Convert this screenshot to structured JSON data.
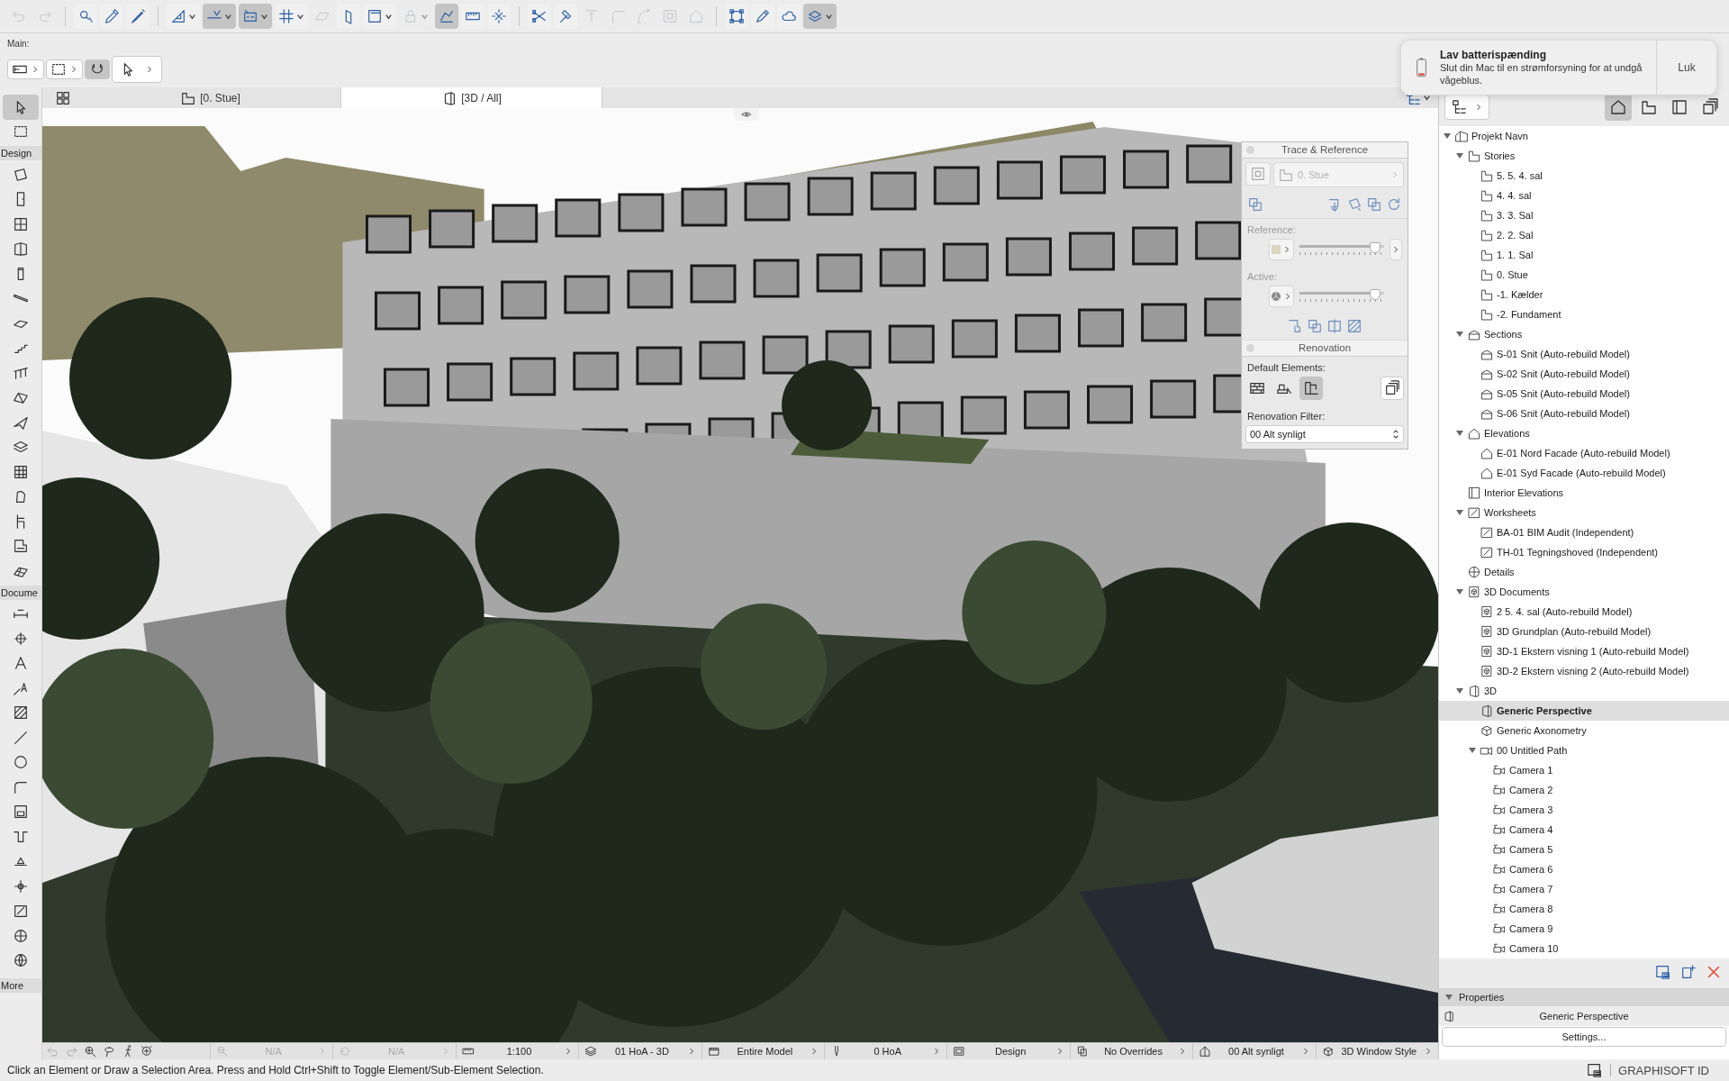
{
  "toolbar": [
    [
      {
        "selected": false,
        "disabled": true,
        "dropdown": false
      },
      {
        "selected": false,
        "disabled": true,
        "dropdown": false
      }
    ],
    [
      {
        "selected": false,
        "disabled": false,
        "dropdown": false
      },
      {
        "selected": false,
        "disabled": false,
        "dropdown": false
      },
      {
        "selected": false,
        "disabled": false,
        "dropdown": false
      }
    ],
    [
      {
        "selected": false,
        "disabled": false,
        "dropdown": true
      },
      {
        "selected": true,
        "disabled": false,
        "dropdown": true
      },
      {
        "selected": true,
        "disabled": false,
        "dropdown": true
      },
      {
        "selected": false,
        "disabled": false,
        "dropdown": true
      },
      {
        "selected": false,
        "disabled": true,
        "dropdown": false
      },
      {
        "selected": false,
        "disabled": false,
        "dropdown": false
      },
      {
        "selected": false,
        "disabled": false,
        "dropdown": true
      },
      {
        "selected": false,
        "disabled": true,
        "dropdown": true
      },
      {
        "selected": true,
        "disabled": false,
        "dropdown": false
      },
      {
        "selected": false,
        "disabled": false,
        "dropdown": false
      },
      {
        "selected": false,
        "disabled": false,
        "dropdown": false
      }
    ],
    [
      {
        "selected": false,
        "disabled": false,
        "dropdown": false
      },
      {
        "selected": false,
        "disabled": false,
        "dropdown": false
      },
      {
        "selected": false,
        "disabled": true,
        "dropdown": false
      },
      {
        "selected": false,
        "disabled": true,
        "dropdown": false
      },
      {
        "selected": false,
        "disabled": true,
        "dropdown": false
      },
      {
        "selected": false,
        "disabled": true,
        "dropdown": false
      },
      {
        "selected": false,
        "disabled": true,
        "dropdown": false
      }
    ],
    [
      {
        "selected": false,
        "disabled": false,
        "dropdown": false
      },
      {
        "selected": false,
        "disabled": false,
        "dropdown": false
      },
      {
        "selected": false,
        "disabled": false,
        "dropdown": false
      },
      {
        "selected": true,
        "disabled": false,
        "dropdown": true
      }
    ]
  ],
  "info_box": {
    "label": "Main:",
    "controls": [
      {
        "selected": false
      },
      {
        "selected": false
      },
      {
        "selected": true
      },
      {
        "selected": false
      }
    ]
  },
  "notification": {
    "title": "Lav batterispænding",
    "body": "Slut din Mac til en strømforsyning for at undgå vågeblus.",
    "button": "Luk"
  },
  "toolbox": {
    "top": [
      {
        "selected": true
      },
      {
        "selected": false
      }
    ],
    "sections": [
      {
        "label": "Design",
        "tools": [
          {
            "selected": false
          },
          {
            "selected": false
          },
          {
            "selected": false
          },
          {
            "selected": false
          },
          {
            "selected": false
          },
          {
            "selected": false
          },
          {
            "selected": false
          },
          {
            "selected": false
          },
          {
            "selected": false
          },
          {
            "selected": false
          },
          {
            "selected": false
          },
          {
            "selected": false
          },
          {
            "selected": false
          },
          {
            "selected": false
          },
          {
            "selected": false
          },
          {
            "selected": false
          },
          {
            "selected": false
          }
        ]
      },
      {
        "label": "Docume",
        "tools": [
          {
            "selected": false
          },
          {
            "selected": false
          },
          {
            "selected": false
          },
          {
            "selected": false
          },
          {
            "selected": false
          },
          {
            "selected": false
          },
          {
            "selected": false
          },
          {
            "selected": false
          },
          {
            "selected": false
          },
          {
            "selected": false
          },
          {
            "selected": false
          },
          {
            "selected": false
          },
          {
            "selected": false
          },
          {
            "selected": false
          },
          {
            "selected": false
          }
        ]
      }
    ],
    "more_label": "More"
  },
  "tabs": [
    {
      "label": "[0. Stue]",
      "kind": "plan",
      "selected": false
    },
    {
      "label": "[3D / All]",
      "kind": "view3d",
      "selected": true
    }
  ],
  "trace_panel": {
    "title": "Trace & Reference",
    "reference_field": {
      "value": "0. Stue",
      "disabled": true
    },
    "reference_label": "Reference:",
    "reference_slider": {
      "level": 0.88
    },
    "active_label": "Active:",
    "active_slider": {
      "level": 0.88
    }
  },
  "renovation_panel": {
    "title": "Renovation",
    "default_label": "Default Elements:",
    "elements": [
      {
        "selected": false
      },
      {
        "selected": false
      },
      {
        "selected": true
      }
    ],
    "filter_label": "Renovation Filter:",
    "filter": {
      "value": "00 Alt synligt"
    }
  },
  "navigator": {
    "views": [
      {
        "selected": true
      },
      {
        "selected": false
      },
      {
        "selected": false
      },
      {
        "selected": false
      }
    ],
    "tree": [
      {
        "label": "Projekt Navn",
        "kind": "project",
        "selected": false,
        "expanded": true,
        "children": [
          {
            "label": "Stories",
            "kind": "story",
            "selected": false,
            "expanded": true,
            "children": [
              {
                "label": "5. 5. 4. sal",
                "kind": "story",
                "selected": false
              },
              {
                "label": "4. 4. sal",
                "kind": "story",
                "selected": false
              },
              {
                "label": "3. 3. Sal",
                "kind": "story",
                "selected": false
              },
              {
                "label": "2. 2. Sal",
                "kind": "story",
                "selected": false
              },
              {
                "label": "1. 1. Sal",
                "kind": "story",
                "selected": false
              },
              {
                "label": "0. Stue",
                "kind": "story",
                "selected": false
              },
              {
                "label": "-1. Kælder",
                "kind": "story",
                "selected": false
              },
              {
                "label": "-2. Fundament",
                "kind": "story",
                "selected": false
              }
            ]
          },
          {
            "label": "Sections",
            "kind": "section",
            "selected": false,
            "expanded": true,
            "children": [
              {
                "label": "S-01 Snit (Auto-rebuild Model)",
                "kind": "section",
                "selected": false
              },
              {
                "label": "S-02 Snit (Auto-rebuild Model)",
                "kind": "section",
                "selected": false
              },
              {
                "label": "S-05 Snit (Auto-rebuild Model)",
                "kind": "section",
                "selected": false
              },
              {
                "label": "S-06 Snit (Auto-rebuild Model)",
                "kind": "section",
                "selected": false
              }
            ]
          },
          {
            "label": "Elevations",
            "kind": "elevation",
            "selected": false,
            "expanded": true,
            "children": [
              {
                "label": "E-01 Nord Facade (Auto-rebuild Model)",
                "kind": "elevation",
                "selected": false
              },
              {
                "label": "E-01 Syd Facade (Auto-rebuild Model)",
                "kind": "elevation",
                "selected": false
              }
            ]
          },
          {
            "label": "Interior Elevations",
            "kind": "interior",
            "selected": false
          },
          {
            "label": "Worksheets",
            "kind": "worksheet",
            "selected": false,
            "expanded": true,
            "children": [
              {
                "label": "BA-01 BIM Audit (Independent)",
                "kind": "worksheet",
                "selected": false
              },
              {
                "label": "TH-01 Tegningshoved (Independent)",
                "kind": "worksheet",
                "selected": false
              }
            ]
          },
          {
            "label": "Details",
            "kind": "detail",
            "selected": false
          },
          {
            "label": "3D Documents",
            "kind": "documents3d",
            "selected": false,
            "expanded": true,
            "children": [
              {
                "label": "2 5. 4. sal (Auto-rebuild Model)",
                "kind": "document3d",
                "selected": false
              },
              {
                "label": "3D Grundplan (Auto-rebuild Model)",
                "kind": "document3d",
                "selected": false
              },
              {
                "label": "3D-1 Ekstern visning 1 (Auto-rebuild Model)",
                "kind": "document3d",
                "selected": false
              },
              {
                "label": "3D-2 Ekstern visning 2 (Auto-rebuild Model)",
                "kind": "document3d",
                "selected": false
              }
            ]
          },
          {
            "label": "3D",
            "kind": "view3d",
            "selected": false,
            "expanded": true,
            "children": [
              {
                "label": "Generic Perspective",
                "kind": "view3d",
                "selected": true
              },
              {
                "label": "Generic Axonometry",
                "kind": "axonometry",
                "selected": false
              },
              {
                "label": "00 Untitled Path",
                "kind": "path",
                "selected": false,
                "expanded": true,
                "children": [
                  {
                    "label": "Camera 1",
                    "kind": "camera",
                    "selected": false
                  },
                  {
                    "label": "Camera 2",
                    "kind": "camera",
                    "selected": false
                  },
                  {
                    "label": "Camera 3",
                    "kind": "camera",
                    "selected": false
                  },
                  {
                    "label": "Camera 4",
                    "kind": "camera",
                    "selected": false
                  },
                  {
                    "label": "Camera 5",
                    "kind": "camera",
                    "selected": false
                  },
                  {
                    "label": "Camera 6",
                    "kind": "camera",
                    "selected": false
                  },
                  {
                    "label": "Camera 7",
                    "kind": "camera",
                    "selected": false
                  },
                  {
                    "label": "Camera 8",
                    "kind": "camera",
                    "selected": false
                  },
                  {
                    "label": "Camera 9",
                    "kind": "camera",
                    "selected": false
                  },
                  {
                    "label": "Camera 10",
                    "kind": "camera",
                    "selected": false
                  }
                ]
              }
            ]
          }
        ]
      }
    ]
  },
  "properties": {
    "title": "Properties",
    "expanded": true,
    "item": "Generic Perspective",
    "button": "Settings..."
  },
  "view_bar": [
    {
      "label": "N/A",
      "disabled": true
    },
    {
      "label": "N/A",
      "disabled": true
    },
    {
      "label": "1:100",
      "disabled": false
    },
    {
      "label": "01 HoA - 3D",
      "disabled": false
    },
    {
      "label": "Entire Model",
      "disabled": false
    },
    {
      "label": "0 HoA",
      "disabled": false
    },
    {
      "label": "Design",
      "disabled": false
    },
    {
      "label": "No Overrides",
      "disabled": false
    },
    {
      "label": "00 Alt synligt",
      "disabled": false
    },
    {
      "label": "3D Window Style",
      "disabled": false
    }
  ],
  "status_bar": {
    "message": "Click an Element or Draw a Selection Area. Press and Hold Ctrl+Shift to Toggle Element/Sub-Element Selection.",
    "account": "GRAPHISOFT ID"
  }
}
